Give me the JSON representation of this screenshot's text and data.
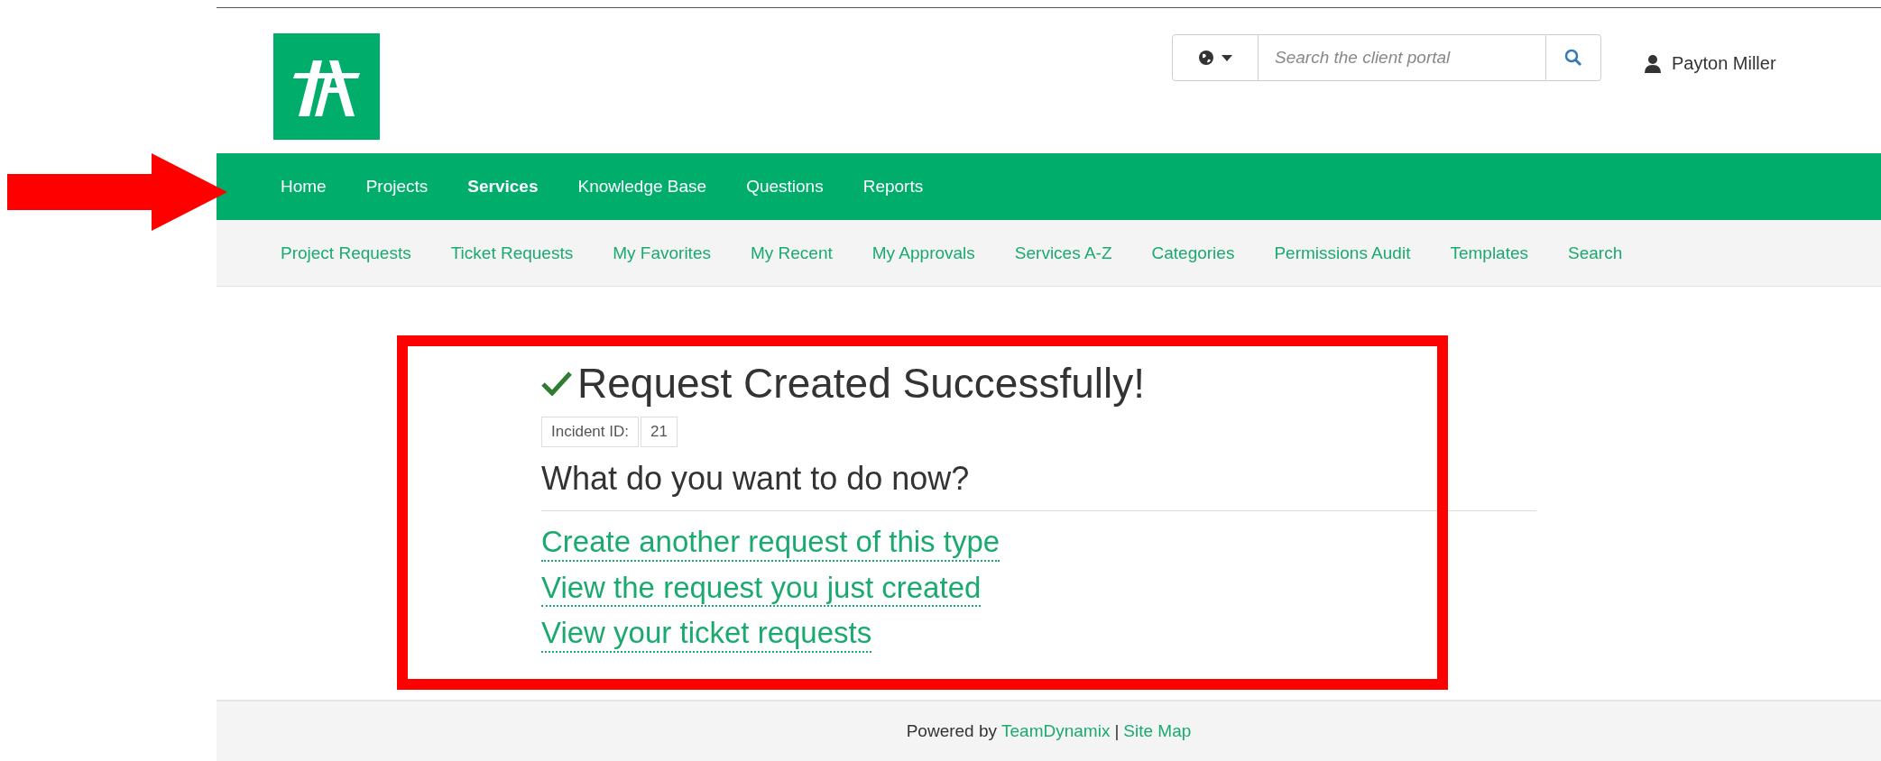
{
  "header": {
    "search": {
      "placeholder": "Search the client portal"
    },
    "user": {
      "name": "Payton Miller"
    }
  },
  "nav": [
    {
      "label": "Home",
      "selected": false
    },
    {
      "label": "Projects",
      "selected": false
    },
    {
      "label": "Services",
      "selected": true
    },
    {
      "label": "Knowledge Base",
      "selected": false
    },
    {
      "label": "Questions",
      "selected": false
    },
    {
      "label": "Reports",
      "selected": false
    }
  ],
  "subnav": [
    "Project Requests",
    "Ticket Requests",
    "My Favorites",
    "My Recent",
    "My Approvals",
    "Services A-Z",
    "Categories",
    "Permissions Audit",
    "Templates",
    "Search"
  ],
  "content": {
    "title": "Request Created Successfully!",
    "incident": {
      "label": "Incident ID:",
      "value": "21"
    },
    "question": "What do you want to do now?",
    "links": [
      "Create another request of this type",
      "View the request you just created",
      "View your ticket requests"
    ]
  },
  "footer": {
    "prefix": "Powered by",
    "link": "TeamDynamix",
    "separator": "|",
    "sitemap": "Site Map"
  },
  "annotations": {
    "arrow": true,
    "highlight_box": true
  }
}
